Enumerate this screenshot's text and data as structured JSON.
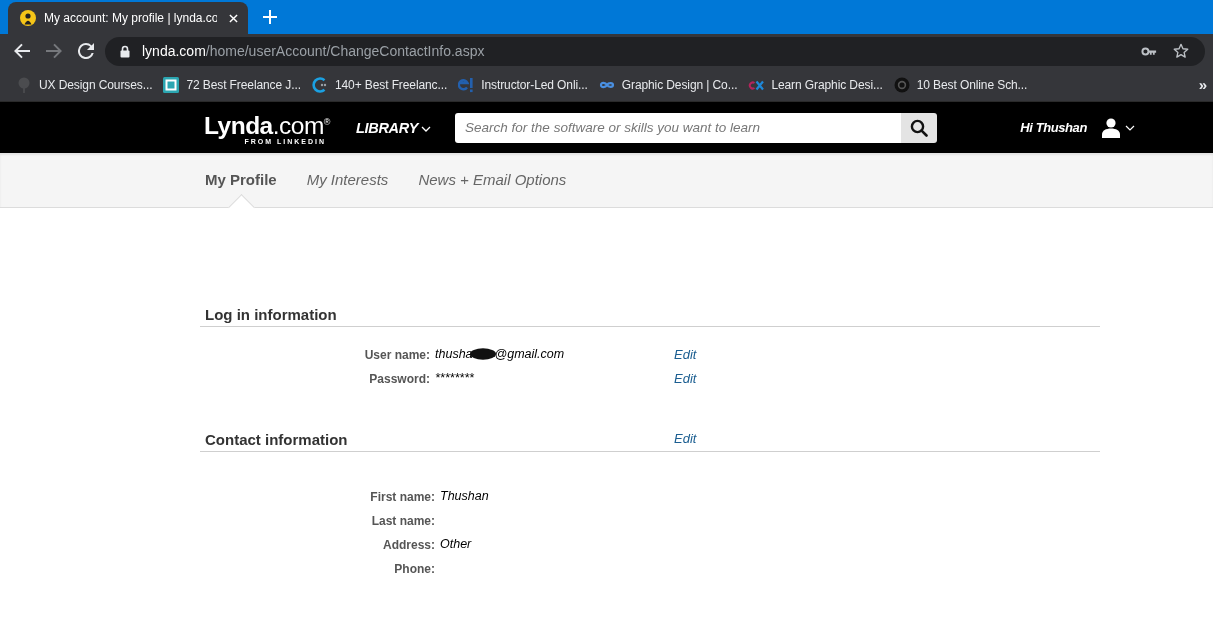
{
  "browser": {
    "tabs": [
      {
        "title": "My account: My profile | lynda.co",
        "selected": true
      }
    ],
    "nav_buttons": [
      {
        "kind": "back",
        "disabled": false
      },
      {
        "kind": "forward",
        "disabled": true
      },
      {
        "kind": "reload",
        "disabled": false
      }
    ],
    "address": {
      "domain": "lynda.com",
      "path": "/home/userAccount/ChangeContactInfo.aspx"
    },
    "bookmarks": [
      {
        "label": "UX Design Courses..."
      },
      {
        "label": "72 Best Freelance J..."
      },
      {
        "label": "140+ Best Freelanc..."
      },
      {
        "label": "Instructor-Led Onli..."
      },
      {
        "label": "Graphic Design | Co..."
      },
      {
        "label": "Learn Graphic Desi..."
      },
      {
        "label": "10 Best Online Sch..."
      }
    ],
    "bookmarks_overflow": "»"
  },
  "site_header": {
    "logo": "**Lynda**.com$^{®}$",
    "logo_tagline": "FROM LINKEDIN",
    "library_menu": "LIBRARY",
    "search": {
      "placeholder": "Search for the software or skills you want to learn"
    },
    "greeting": "Hi Thushan"
  },
  "profile_tabs": [
    {
      "label": "My Profile",
      "selected": true
    },
    {
      "label": "My Interests",
      "selected": false
    },
    {
      "label": "News + Email Options",
      "selected": false
    }
  ],
  "sections": [
    {
      "title": "Log in information",
      "fields": [
        {
          "label": "User name:",
          "value_parts": [
            "thusha",
            "@gmail.com"
          ],
          "redacted": true,
          "edit": "Edit"
        },
        {
          "label": "Password:",
          "value_parts": [
            "********"
          ],
          "redacted": false,
          "edit": "Edit"
        }
      ]
    },
    {
      "title": "Contact information",
      "edit": "Edit",
      "fields": [
        {
          "label": "First name:",
          "value_parts": [
            "Thushan"
          ],
          "redacted": false
        },
        {
          "label": "Last name:",
          "redacted": false
        },
        {
          "label": "Address:",
          "value_parts": [
            "Other"
          ],
          "redacted": false
        },
        {
          "label": "Phone:",
          "redacted": false
        }
      ]
    }
  ]
}
